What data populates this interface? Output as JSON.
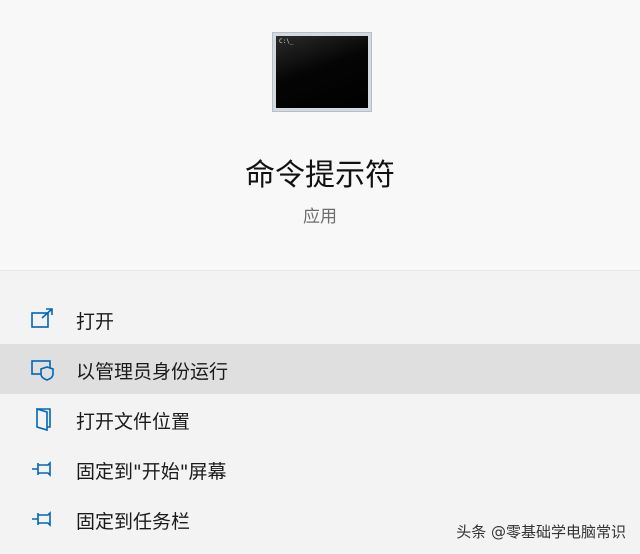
{
  "app": {
    "icon": "command-prompt-icon",
    "icon_prompt_text": "C:\\_",
    "title": "命令提示符",
    "type": "应用"
  },
  "menu": {
    "items": [
      {
        "label": "打开",
        "icon": "open-icon"
      },
      {
        "label": "以管理员身份运行",
        "icon": "shield-admin-icon",
        "highlighted": true
      },
      {
        "label": "打开文件位置",
        "icon": "file-location-icon"
      },
      {
        "label": "固定到\"开始\"屏幕",
        "icon": "pin-icon"
      },
      {
        "label": "固定到任务栏",
        "icon": "pin-icon"
      }
    ]
  },
  "colors": {
    "accent": "#0067b8",
    "highlight": "#dfdfdf",
    "background": "#f3f3f3"
  },
  "watermark": "头条 @零基础学电脑常识"
}
